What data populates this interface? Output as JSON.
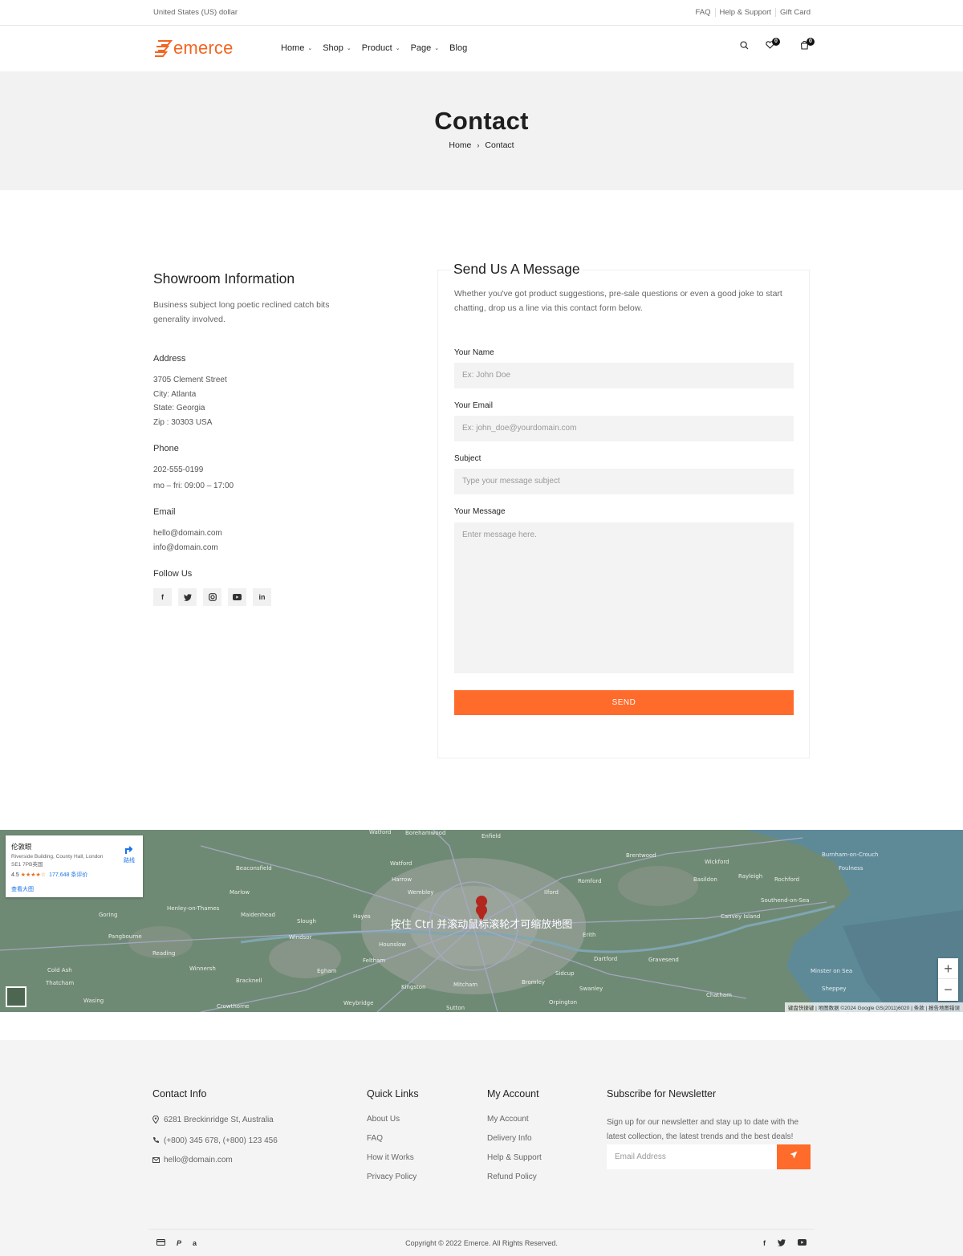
{
  "topbar": {
    "currency": "United States (US) dollar",
    "links": [
      "FAQ",
      "Help & Support",
      "Gift Card"
    ]
  },
  "header": {
    "logo_text": "emerce",
    "nav": [
      {
        "label": "Home",
        "has_dropdown": true
      },
      {
        "label": "Shop",
        "has_dropdown": true
      },
      {
        "label": "Product",
        "has_dropdown": true
      },
      {
        "label": "Page",
        "has_dropdown": true
      },
      {
        "label": "Blog",
        "has_dropdown": false
      }
    ],
    "wishlist_count": "0",
    "cart_count": "0",
    "icons": [
      "search-icon",
      "heart-icon",
      "cart-icon"
    ]
  },
  "hero": {
    "title": "Contact",
    "breadcrumb": [
      "Home",
      "Contact"
    ]
  },
  "showroom": {
    "title": "Showroom Information",
    "lead": "Business subject long poetic reclined catch bits generality involved.",
    "address_title": "Address",
    "address": [
      "3705 Clement Street",
      "City: Atlanta",
      "State: Georgia",
      "Zip : 30303 USA"
    ],
    "phone_title": "Phone",
    "phone": [
      "202-555-0199",
      "mo – fri: 09:00 – 17:00"
    ],
    "email_title": "Email",
    "email": [
      "hello@domain.com",
      "info@domain.com"
    ],
    "follow_title": "Follow Us",
    "social": [
      "f",
      "t",
      "ig",
      "yt",
      "in"
    ]
  },
  "form": {
    "title": "Send Us A Message",
    "intro": "Whether you've got product suggestions, pre-sale questions or even a good joke to start chatting, drop us a line via this contact form below.",
    "name_label": "Your Name",
    "name_placeholder": "Ex: John Doe",
    "email_label": "Your Email",
    "email_placeholder": "Ex: john_doe@yourdomain.com",
    "subject_label": "Subject",
    "subject_placeholder": "Type your message subject",
    "message_label": "Your Message",
    "message_placeholder": "Enter message here.",
    "send_label": "SEND"
  },
  "map": {
    "place_name": "伦敦眼",
    "place_address": "Riverside Building, County Hall, London SE1 7PB英国",
    "rating": "4.5",
    "stars": "★★★★☆",
    "review_count": "177,648 条评价",
    "view_larger": "查看大图",
    "directions": "路线",
    "hint": "按住 Ctrl 并滚动鼠标滚轮才可缩放地图",
    "attribution": "键盘快捷键 | 地图数据 ©2024 Google GS(2011)6020 | 条款 | 报告地图错误",
    "zoom_in": "+",
    "zoom_out": "−"
  },
  "footer": {
    "contact_title": "Contact Info",
    "contact": [
      {
        "icon": "location-pin-icon",
        "text": "6281 Breckinridge St, Australia"
      },
      {
        "icon": "phone-icon",
        "text": "(+800) 345 678, (+800) 123 456"
      },
      {
        "icon": "mail-icon",
        "text": "hello@domain.com"
      }
    ],
    "quick_title": "Quick Links",
    "quick": [
      "About Us",
      "FAQ",
      "How it Works",
      "Privacy Policy"
    ],
    "account_title": "My Account",
    "account": [
      "My Account",
      "Delivery Info",
      "Help & Support",
      "Refund Policy"
    ],
    "newsletter_title": "Subscribe for Newsletter",
    "newsletter_text": "Sign up for our newsletter and stay up to date with the latest collection, the latest trends and the best deals!",
    "newsletter_placeholder": "Email Address",
    "copyright": "Copyright © 2022 Emerce. All Rights Reserved."
  },
  "colors": {
    "accent": "#fe6b2b",
    "logo": "#f26522",
    "hero_bg": "#f2f2f2",
    "footer_bg": "#f4f4f4"
  }
}
